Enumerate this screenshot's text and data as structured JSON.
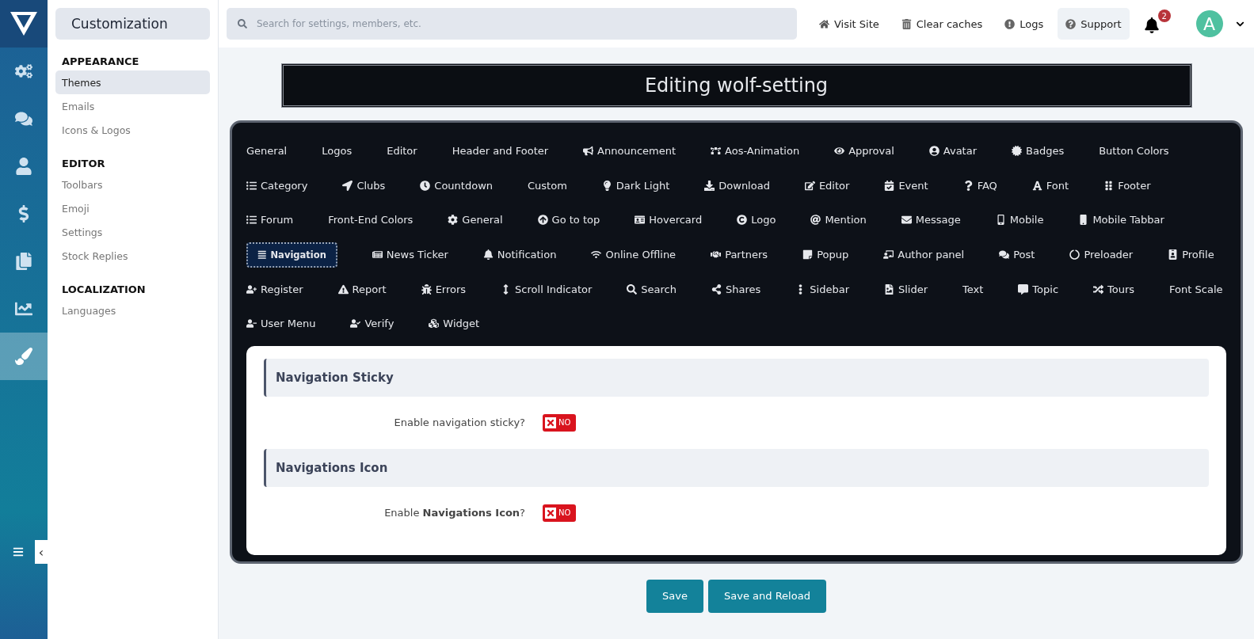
{
  "nav_rail": {
    "items": [
      {
        "selected": false
      },
      {
        "selected": false
      },
      {
        "selected": false
      },
      {
        "selected": false
      },
      {
        "selected": false
      },
      {
        "selected": false
      },
      {
        "selected": true
      }
    ],
    "collapse_label": "‹"
  },
  "sidebar": {
    "title": "Customization",
    "sections": [
      {
        "heading": "APPEARANCE",
        "items": [
          {
            "label": "Themes",
            "selected": true
          },
          {
            "label": "Emails",
            "selected": false
          },
          {
            "label": "Icons & Logos",
            "selected": false
          }
        ]
      },
      {
        "heading": "EDITOR",
        "items": [
          {
            "label": "Toolbars",
            "selected": false
          },
          {
            "label": "Emoji",
            "selected": false
          },
          {
            "label": "Settings",
            "selected": false
          },
          {
            "label": "Stock Replies",
            "selected": false
          }
        ]
      },
      {
        "heading": "LOCALIZATION",
        "items": [
          {
            "label": "Languages",
            "selected": false
          }
        ]
      }
    ]
  },
  "topbar": {
    "search": {
      "placeholder": "Search for settings, members, etc."
    },
    "links": [
      {
        "label": "Visit Site"
      },
      {
        "label": "Clear caches"
      },
      {
        "label": "Logs"
      },
      {
        "label": "Support"
      }
    ],
    "notifications": "2",
    "avatar": "A"
  },
  "page_title": "Editing wolf-setting",
  "tabs": [
    {
      "label": "General",
      "selected": false
    },
    {
      "label": "Logos",
      "selected": false
    },
    {
      "label": "Editor",
      "selected": false
    },
    {
      "label": "Header and Footer",
      "selected": false
    },
    {
      "label": "Announcement",
      "selected": false
    },
    {
      "label": "Aos-Animation",
      "selected": false
    },
    {
      "label": "Approval",
      "selected": false
    },
    {
      "label": "Avatar",
      "selected": false
    },
    {
      "label": "Badges",
      "selected": false
    },
    {
      "label": "Button Colors",
      "selected": false
    },
    {
      "label": "Category",
      "selected": false
    },
    {
      "label": "Clubs",
      "selected": false
    },
    {
      "label": "Countdown",
      "selected": false
    },
    {
      "label": "Custom",
      "selected": false
    },
    {
      "label": "Dark Light",
      "selected": false
    },
    {
      "label": "Download",
      "selected": false
    },
    {
      "label": "Editor",
      "selected": false
    },
    {
      "label": "Event",
      "selected": false
    },
    {
      "label": "FAQ",
      "selected": false
    },
    {
      "label": "Font",
      "selected": false
    },
    {
      "label": "Footer",
      "selected": false
    },
    {
      "label": "Forum",
      "selected": false
    },
    {
      "label": "Front-End Colors",
      "selected": false
    },
    {
      "label": "General",
      "selected": false
    },
    {
      "label": "Go to top",
      "selected": false
    },
    {
      "label": "Hovercard",
      "selected": false
    },
    {
      "label": "Logo",
      "selected": false
    },
    {
      "label": "Mention",
      "selected": false
    },
    {
      "label": "Message",
      "selected": false
    },
    {
      "label": "Mobile",
      "selected": false
    },
    {
      "label": "Mobile Tabbar",
      "selected": false
    },
    {
      "label": "Navigation",
      "selected": true
    },
    {
      "label": "News Ticker",
      "selected": false
    },
    {
      "label": "Notification",
      "selected": false
    },
    {
      "label": "Online Offline",
      "selected": false
    },
    {
      "label": "Partners",
      "selected": false
    },
    {
      "label": "Popup",
      "selected": false
    },
    {
      "label": "Author panel",
      "selected": false
    },
    {
      "label": "Post",
      "selected": false
    },
    {
      "label": "Preloader",
      "selected": false
    },
    {
      "label": "Profile",
      "selected": false
    },
    {
      "label": "Register",
      "selected": false
    },
    {
      "label": "Report",
      "selected": false
    },
    {
      "label": "Errors",
      "selected": false
    },
    {
      "label": "Scroll Indicator",
      "selected": false
    },
    {
      "label": "Search",
      "selected": false
    },
    {
      "label": "Shares",
      "selected": false
    },
    {
      "label": "Sidebar",
      "selected": false
    },
    {
      "label": "Slider",
      "selected": false
    },
    {
      "label": "Text",
      "selected": false
    },
    {
      "label": "Topic",
      "selected": false
    },
    {
      "label": "Tours",
      "selected": false
    },
    {
      "label": "Font Scale",
      "selected": false
    },
    {
      "label": "User Menu",
      "selected": false
    },
    {
      "label": "Verify",
      "selected": false
    },
    {
      "label": "Widget",
      "selected": false
    }
  ],
  "sections": [
    {
      "title": "Navigation Sticky",
      "option": {
        "label": "Enable navigation sticky?",
        "on": false,
        "toggle_label": "NO"
      }
    },
    {
      "title": "Navigations Icon",
      "option": {
        "label": "Enable **Navigations Icon**?",
        "on": false,
        "toggle_label": "NO"
      }
    }
  ],
  "buttons": [
    {
      "label": "Save"
    },
    {
      "label": "Save and Reload"
    }
  ]
}
